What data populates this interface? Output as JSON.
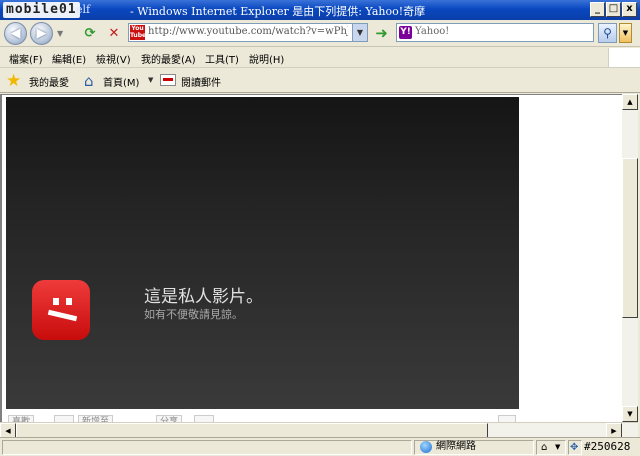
{
  "window": {
    "logo_text": "mobile01",
    "title_prefix": "elf",
    "title": "- Windows Internet Explorer 是由下列提供: Yahoo!奇摩",
    "controls": [
      "_",
      "□",
      "x"
    ]
  },
  "address_bar": {
    "url": "http://www.youtube.com/watch?v=wPhJRbtFGdQ",
    "site_icon_text": "You Tube"
  },
  "search": {
    "placeholder": "Yahoo!",
    "engine_icon": "Y!"
  },
  "menu": {
    "items": [
      "檔案(F)",
      "編輯(E)",
      "檢視(V)",
      "我的最愛(A)",
      "工具(T)",
      "說明(H)"
    ]
  },
  "favorites_bar": {
    "favorites_label": "我的最愛",
    "home_label": "首頁(M)",
    "mail_label": "閱讀郵件"
  },
  "video": {
    "error_title": "這是私人影片。",
    "error_subtitle": "如有不便敬請見諒。"
  },
  "action_bar": {
    "buttons": [
      "喜歡",
      "",
      "新增至",
      "分享",
      ""
    ]
  },
  "status_bar": {
    "zone_label": "網際網路",
    "zoom_label": "▼",
    "watermark": "#250628"
  },
  "colors": {
    "titlebar": "#0a48c0",
    "error_red": "#e02020",
    "player_bg": "#242424"
  }
}
